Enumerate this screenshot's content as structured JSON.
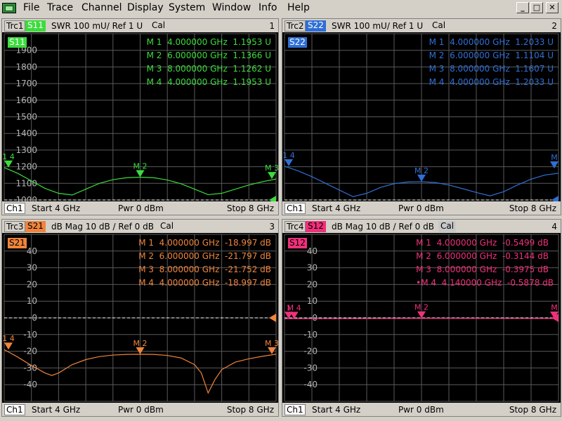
{
  "menu": {
    "items": [
      "File",
      "Trace",
      "Channel",
      "Display",
      "System",
      "Window",
      "Info",
      "Help"
    ],
    "win_controls": [
      "_",
      "□",
      "✕"
    ]
  },
  "panels": [
    {
      "trc": "Trc1",
      "param": "S11",
      "format": "SWR",
      "scale": "100 mU/",
      "ref": "Ref 1 U",
      "cal": "Cal",
      "window_num": "1",
      "color": "#3cdc3c",
      "tag_fg": "#ffffff",
      "ylabels": [
        "1900",
        "1800",
        "1700",
        "1600",
        "1500",
        "1400",
        "1300",
        "1200",
        "1100",
        "1000"
      ],
      "ylim": [
        1000,
        2000
      ],
      "ref_value": 1000,
      "markers": [
        {
          "name": "M 1",
          "freq": "4.000000 GHz",
          "value": "1.1953 U"
        },
        {
          "name": "M 2",
          "freq": "6.000000 GHz",
          "value": "1.1366 U"
        },
        {
          "name": "M 3",
          "freq": "8.000000 GHz",
          "value": "1.1262 U"
        },
        {
          "name": "M 4",
          "freq": "4.000000 GHz",
          "value": "1.1953 U"
        }
      ],
      "plot_markers": [
        {
          "label": "1 4",
          "x": 4.0,
          "y": 1195
        },
        {
          "label": "M 2",
          "x": 6.0,
          "y": 1137
        },
        {
          "label": "M 3",
          "x": 8.0,
          "y": 1126
        }
      ],
      "trace": {
        "x": [
          4.0,
          4.2,
          4.4,
          4.6,
          4.8,
          5.0,
          5.2,
          5.4,
          5.6,
          5.8,
          6.0,
          6.2,
          6.4,
          6.6,
          6.8,
          7.0,
          7.2,
          7.4,
          7.6,
          7.8,
          8.0
        ],
        "y": [
          1195,
          1160,
          1115,
          1070,
          1040,
          1030,
          1065,
          1100,
          1122,
          1134,
          1137,
          1134,
          1120,
          1098,
          1065,
          1032,
          1040,
          1065,
          1090,
          1110,
          1126
        ]
      },
      "footer": {
        "ch": "Ch1",
        "start": "Start  4 GHz",
        "pwr": "Pwr  0 dBm",
        "stop": "Stop  8 GHz"
      }
    },
    {
      "trc": "Trc2",
      "param": "S22",
      "format": "SWR",
      "scale": "100 mU/",
      "ref": "Ref 1 U",
      "cal": "Cal",
      "window_num": "2",
      "color": "#2f6fd6",
      "tag_fg": "#ffffff",
      "ylabels": [],
      "ylim": [
        1000,
        2000
      ],
      "ref_value": 1000,
      "markers": [
        {
          "name": "M 1",
          "freq": "4.000000 GHz",
          "value": "1.2033 U"
        },
        {
          "name": "M 2",
          "freq": "6.000000 GHz",
          "value": "1.1104 U"
        },
        {
          "name": "M 3",
          "freq": "8.000000 GHz",
          "value": "1.1607 U"
        },
        {
          "name": "M 4",
          "freq": "4.000000 GHz",
          "value": "1.2033 U"
        }
      ],
      "plot_markers": [
        {
          "label": "1 4",
          "x": 4.0,
          "y": 1203
        },
        {
          "label": "M 2",
          "x": 6.0,
          "y": 1110
        },
        {
          "label": "M",
          "x": 8.0,
          "y": 1190
        }
      ],
      "trace": {
        "x": [
          4.0,
          4.2,
          4.4,
          4.6,
          4.8,
          5.0,
          5.2,
          5.4,
          5.6,
          5.8,
          6.0,
          6.2,
          6.4,
          6.6,
          6.8,
          7.0,
          7.2,
          7.4,
          7.6,
          7.8,
          8.0
        ],
        "y": [
          1203,
          1175,
          1140,
          1100,
          1060,
          1020,
          1040,
          1075,
          1098,
          1108,
          1110,
          1105,
          1090,
          1068,
          1045,
          1025,
          1050,
          1090,
          1125,
          1150,
          1161
        ]
      },
      "footer": {
        "ch": "Ch1",
        "start": "Start  4 GHz",
        "pwr": "Pwr  0 dBm",
        "stop": "Stop  8 GHz"
      }
    },
    {
      "trc": "Trc3",
      "param": "S21",
      "format": "dB Mag",
      "scale": "10 dB /",
      "ref": "Ref 0 dB",
      "cal": "Cal",
      "window_num": "3",
      "color": "#f0843c",
      "tag_fg": "#000000",
      "ylabels": [
        "40",
        "30",
        "20",
        "10",
        "0",
        "-10",
        "-20",
        "-30",
        "-40"
      ],
      "ylim": [
        -50,
        50
      ],
      "ref_value": 0,
      "markers": [
        {
          "name": "M 1",
          "freq": "4.000000 GHz",
          "value": "-18.997 dB"
        },
        {
          "name": "M 2",
          "freq": "6.000000 GHz",
          "value": "-21.797 dB"
        },
        {
          "name": "M 3",
          "freq": "8.000000 GHz",
          "value": "-21.752 dB"
        },
        {
          "name": "M 4",
          "freq": "4.000000 GHz",
          "value": "-18.997 dB"
        }
      ],
      "plot_markers": [
        {
          "label": "1 4",
          "x": 4.0,
          "y": -19.0
        },
        {
          "label": "M 2",
          "x": 6.0,
          "y": -21.8
        },
        {
          "label": "M 3",
          "x": 8.0,
          "y": -21.75
        }
      ],
      "trace": {
        "x": [
          4.0,
          4.2,
          4.4,
          4.6,
          4.7,
          4.8,
          5.0,
          5.2,
          5.4,
          5.6,
          5.8,
          6.0,
          6.2,
          6.4,
          6.6,
          6.8,
          6.9,
          7.0,
          7.1,
          7.2,
          7.4,
          7.6,
          7.8,
          8.0
        ],
        "y": [
          -19,
          -23.5,
          -28.5,
          -33,
          -34.5,
          -33,
          -28,
          -25,
          -23.2,
          -22.3,
          -21.9,
          -21.8,
          -21.9,
          -22.5,
          -24,
          -28,
          -33,
          -45,
          -37,
          -31,
          -26.5,
          -24.5,
          -23,
          -21.75
        ]
      },
      "footer": {
        "ch": "Ch1",
        "start": "Start  4 GHz",
        "pwr": "Pwr  0 dBm",
        "stop": "Stop  8 GHz"
      }
    },
    {
      "trc": "Trc4",
      "param": "S12",
      "format": "dB Mag",
      "scale": "10 dB /",
      "ref": "Ref 0 dB",
      "cal": "Cal",
      "window_num": "4",
      "color": "#f0307a",
      "tag_fg": "#000000",
      "ylabels": [
        "40",
        "30",
        "20",
        "10",
        "0",
        "-10",
        "-20",
        "-30",
        "-40"
      ],
      "ylim": [
        -50,
        50
      ],
      "ref_value": 0,
      "markers": [
        {
          "name": "M 1",
          "freq": "4.000000 GHz",
          "value": "-0.5499 dB"
        },
        {
          "name": "M 2",
          "freq": "6.000000 GHz",
          "value": "-0.3144 dB"
        },
        {
          "name": "M 3",
          "freq": "8.000000 GHz",
          "value": "-0.3975 dB"
        },
        {
          "name": "•M 4",
          "freq": "4.140000 GHz",
          "value": "-0.5878 dB"
        }
      ],
      "plot_markers": [
        {
          "label": "1",
          "x": 4.0,
          "y": -0.55
        },
        {
          "label": "M 4",
          "x": 4.14,
          "y": -0.59
        },
        {
          "label": "M 2",
          "x": 6.0,
          "y": -0.31
        },
        {
          "label": "M",
          "x": 8.0,
          "y": -0.4
        }
      ],
      "trace": {
        "x": [
          4.0,
          5.0,
          6.0,
          7.0,
          8.0
        ],
        "y": [
          -0.55,
          -0.45,
          -0.31,
          -0.35,
          -0.4
        ]
      },
      "footer": {
        "ch": "Ch1",
        "start": "Start  4 GHz",
        "pwr": "Pwr  0 dBm",
        "stop": "Stop  8 GHz"
      }
    }
  ],
  "chart_data": [
    {
      "type": "line",
      "title": "Trc1 S11 SWR",
      "x": [
        4.0,
        5.0,
        6.0,
        7.0,
        8.0
      ],
      "series": [
        {
          "name": "S11",
          "values": [
            1.1953,
            1.03,
            1.1366,
            1.032,
            1.1262
          ]
        }
      ],
      "xlim": [
        4,
        8
      ]
    },
    {
      "type": "line",
      "title": "Trc2 S22 SWR",
      "x": [
        4.0,
        5.0,
        6.0,
        7.0,
        8.0
      ],
      "series": [
        {
          "name": "S22",
          "values": [
            1.2033,
            1.02,
            1.1104,
            1.025,
            1.1607
          ]
        }
      ],
      "xlim": [
        4,
        8
      ]
    },
    {
      "type": "line",
      "title": "Trc3 S21 dB Mag",
      "x": [
        4.0,
        4.7,
        6.0,
        7.0,
        8.0
      ],
      "series": [
        {
          "name": "S21",
          "values": [
            -18.997,
            -34.5,
            -21.797,
            -45,
            -21.752
          ]
        }
      ],
      "ylim": [
        -50,
        50
      ],
      "xlim": [
        4,
        8
      ]
    },
    {
      "type": "line",
      "title": "Trc4 S12 dB Mag",
      "x": [
        4.0,
        4.14,
        6.0,
        8.0
      ],
      "series": [
        {
          "name": "S12",
          "values": [
            -0.5499,
            -0.5878,
            -0.3144,
            -0.3975
          ]
        }
      ],
      "ylim": [
        -50,
        50
      ],
      "xlim": [
        4,
        8
      ]
    }
  ]
}
